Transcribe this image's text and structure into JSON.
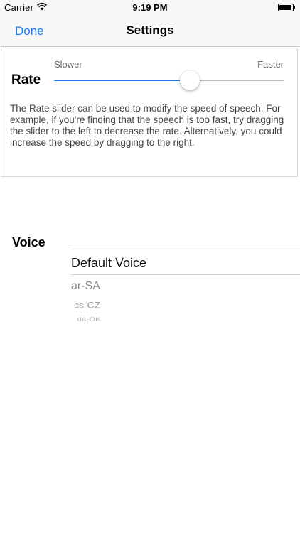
{
  "status_bar": {
    "carrier": "Carrier",
    "time": "9:19 PM",
    "icons": [
      "wifi-icon",
      "battery-icon"
    ]
  },
  "nav": {
    "done_label": "Done",
    "title": "Settings",
    "accent_color": "#1a7cf4"
  },
  "rate": {
    "label": "Rate",
    "min_label": "Slower",
    "max_label": "Faster",
    "slider_value": 0.59,
    "description": "The Rate slider can be used to modify the speed of speech. For example, if you're finding that the speech is too fast, try dragging the slider to the left to decrease the rate. Alternatively, you could increase the speed by dragging to the right."
  },
  "voice": {
    "label": "Voice",
    "selected": "Default Voice",
    "options": [
      "ar-SA",
      "cs-CZ",
      "da-DK"
    ]
  }
}
